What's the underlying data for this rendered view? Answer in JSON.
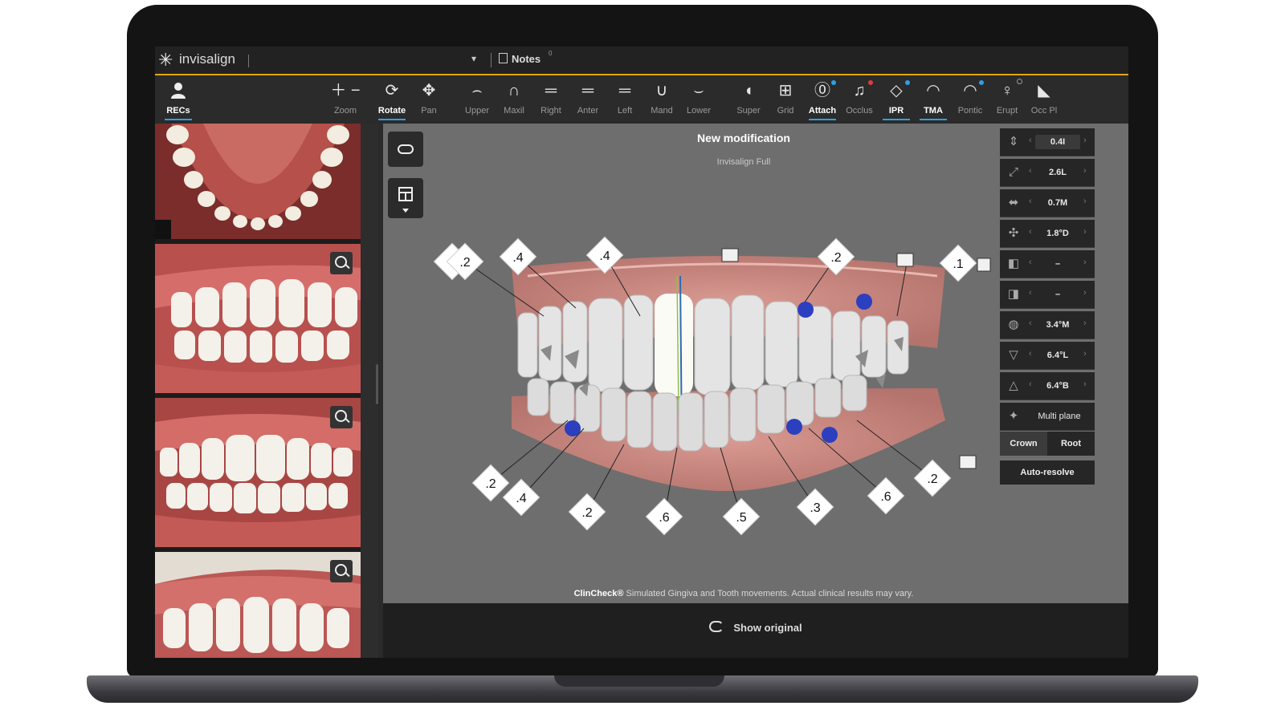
{
  "app": {
    "logo": "invisalign",
    "dropdown_caret": "▾",
    "notes_label": "Notes",
    "notes_count": "0",
    "accent_color": "#e0a416",
    "selection_color": "#2ea0e6"
  },
  "toolbar": {
    "recs": {
      "label": "RECs",
      "icon": "person-icon"
    },
    "tools": [
      {
        "key": "zoom",
        "label": "Zoom",
        "icon": "＋ −"
      },
      {
        "key": "rotate",
        "label": "Rotate",
        "icon": "⟳"
      },
      {
        "key": "pan",
        "label": "Pan",
        "icon": "✥"
      },
      {
        "key": "upper",
        "label": "Upper",
        "icon": "⌢"
      },
      {
        "key": "maxil",
        "label": "Maxil",
        "icon": "∩"
      },
      {
        "key": "right",
        "label": "Right",
        "icon": "═"
      },
      {
        "key": "anter",
        "label": "Anter",
        "icon": "═"
      },
      {
        "key": "left",
        "label": "Left",
        "icon": "═"
      },
      {
        "key": "mand",
        "label": "Mand",
        "icon": "∪"
      },
      {
        "key": "lower",
        "label": "Lower",
        "icon": "⌣"
      },
      {
        "key": "super",
        "label": "Super",
        "icon": "◖"
      },
      {
        "key": "grid",
        "label": "Grid",
        "icon": "⊞"
      },
      {
        "key": "attach",
        "label": "Attach",
        "icon": "⓪"
      },
      {
        "key": "occlus",
        "label": "Occlus",
        "icon": "♫"
      },
      {
        "key": "ipr",
        "label": "IPR",
        "icon": "◇"
      },
      {
        "key": "tma",
        "label": "TMA",
        "icon": "◠"
      },
      {
        "key": "pontic",
        "label": "Pontic",
        "icon": "◠"
      },
      {
        "key": "erupt",
        "label": "Erupt",
        "icon": "♀"
      },
      {
        "key": "occpl",
        "label": "Occ Pl",
        "icon": "◣"
      }
    ]
  },
  "viewer": {
    "title": "New modification",
    "subtitle": "Invisalign Full",
    "disclaimer_brand": "ClinCheck®",
    "disclaimer_text": " Simulated Gingiva and Tooth movements. Actual clinical results may vary.",
    "ipr_upper": [
      ".2",
      ".2",
      ".4",
      ".4",
      ".2",
      ".1"
    ],
    "ipr_lower": [
      ".2",
      ".4",
      ".2",
      ".6",
      ".5",
      ".3",
      ".6",
      ".2"
    ]
  },
  "movement_panel": {
    "rows": [
      {
        "icon": "extrusion-icon",
        "value": "0.4I"
      },
      {
        "icon": "translation-bl-icon",
        "value": "2.6L"
      },
      {
        "icon": "translation-md-icon",
        "value": "0.7M"
      },
      {
        "icon": "rotation-icon",
        "value": "1.8°D"
      },
      {
        "icon": "angulation-icon",
        "value": "–"
      },
      {
        "icon": "inclination-icon",
        "value": "–"
      },
      {
        "icon": "root-md-icon",
        "value": "3.4°M"
      },
      {
        "icon": "root-bl-icon",
        "value": "6.4°L"
      },
      {
        "icon": "torque-icon",
        "value": "6.4°B"
      },
      {
        "icon": "multiplane-icon",
        "value": "Multi plane"
      }
    ],
    "crown_label": "Crown",
    "root_label": "Root",
    "autoresolve_label": "Auto-resolve"
  },
  "footer": {
    "show_original_label": "Show original"
  }
}
